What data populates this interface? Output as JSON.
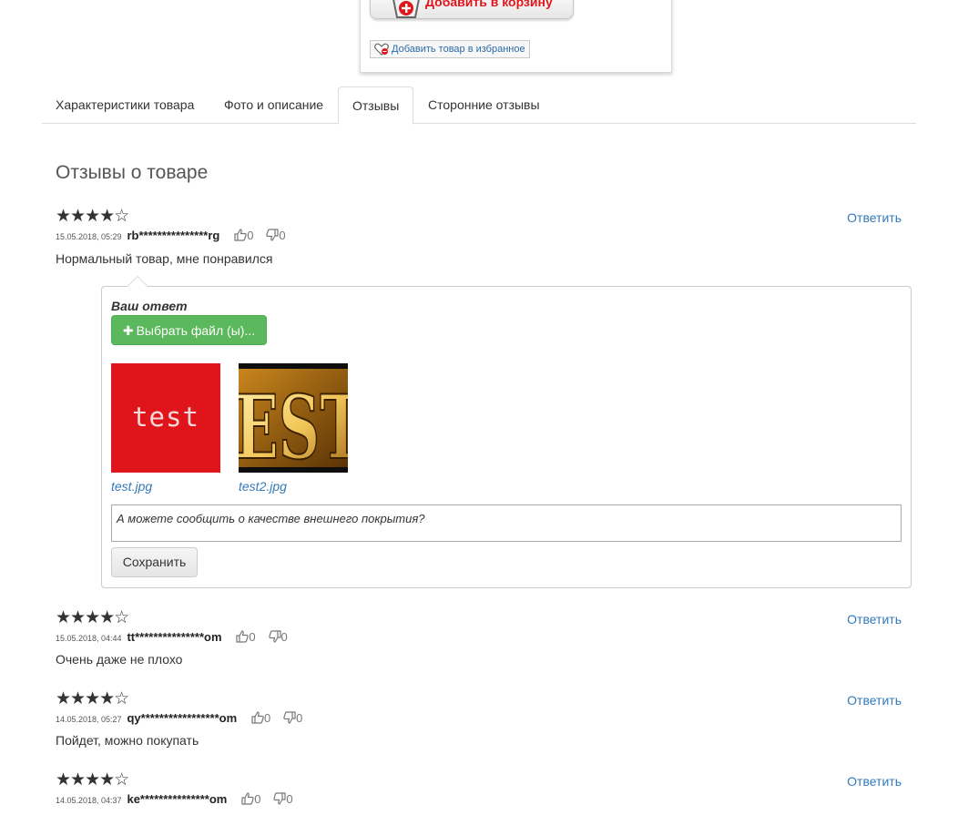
{
  "product": {
    "add_to_cart": "Добавить в корзину",
    "add_to_favorites": "Добавить товар в избранное"
  },
  "tabs": [
    {
      "label": "Характеристики товара"
    },
    {
      "label": "Фото и описание"
    },
    {
      "label": "Отзывы"
    },
    {
      "label": "Сторонние отзывы"
    }
  ],
  "active_tab": "Отзывы",
  "reviews_title": "Отзывы о товаре",
  "reply_link": "Ответить",
  "reviews": [
    {
      "stars": "★★★★☆",
      "rating": 4,
      "date": "15.05.2018, 05:29",
      "author": "rb***************rg",
      "likes": "0",
      "dislikes": "0",
      "text": "Нормальный товар, мне понравился"
    },
    {
      "stars": "★★★★☆",
      "rating": 4,
      "date": "15.05.2018, 04:44",
      "author": "tt***************om",
      "likes": "0",
      "dislikes": "0",
      "text": "Очень даже не плохо"
    },
    {
      "stars": "★★★★☆",
      "rating": 4,
      "date": "14.05.2018, 05:27",
      "author": "qy*****************om",
      "likes": "0",
      "dislikes": "0",
      "text": "Пойдет, можно покупать"
    },
    {
      "stars": "★★★★☆",
      "rating": 4,
      "date": "14.05.2018, 04:37",
      "author": "ke***************om",
      "likes": "0",
      "dislikes": "0",
      "text": ""
    }
  ],
  "reply_form": {
    "heading": "Ваш ответ",
    "choose_files": "Выбрать файл (ы)...",
    "attachments": [
      {
        "file": "test.jpg",
        "thumb_text": "test"
      },
      {
        "file": "test2.jpg",
        "thumb_text": "EST"
      }
    ],
    "text": "А можете сообщить о качестве внешнего покрытия?",
    "save": "Сохранить"
  },
  "colors": {
    "star": "#f0a10c",
    "link": "#337ab7",
    "success": "#5cb85c",
    "cart_text": "#e0161d"
  }
}
